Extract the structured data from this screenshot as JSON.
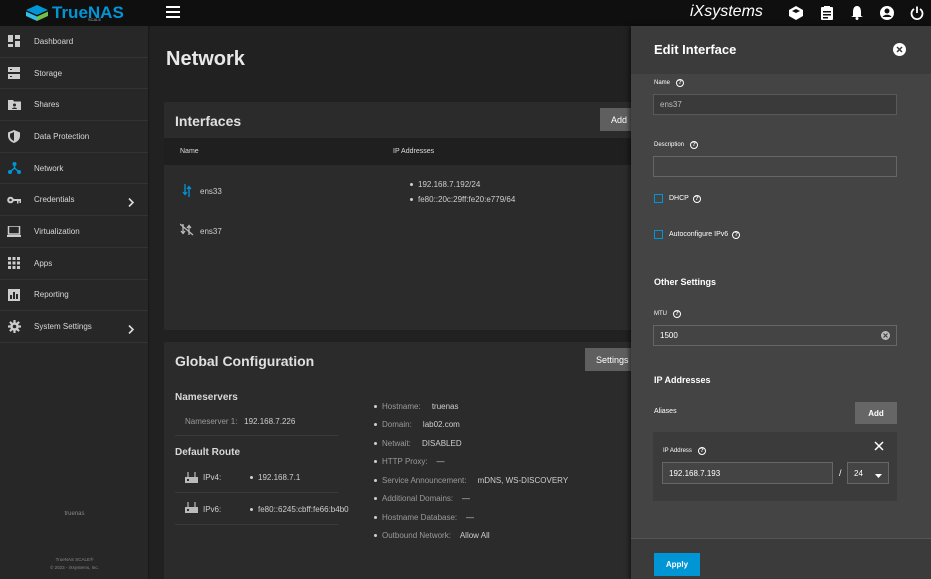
{
  "app": {
    "logo_text": "TrueNAS",
    "logo_sub": "SCALE",
    "vendor": "iXsystems"
  },
  "sidebar": {
    "items": [
      {
        "label": "Dashboard",
        "icon": "dashboard-icon"
      },
      {
        "label": "Storage",
        "icon": "storage-icon"
      },
      {
        "label": "Shares",
        "icon": "shares-icon"
      },
      {
        "label": "Data Protection",
        "icon": "shield-icon"
      },
      {
        "label": "Network",
        "icon": "network-icon"
      },
      {
        "label": "Credentials",
        "icon": "key-icon"
      },
      {
        "label": "Virtualization",
        "icon": "laptop-icon"
      },
      {
        "label": "Apps",
        "icon": "apps-grid-icon"
      },
      {
        "label": "Reporting",
        "icon": "chart-icon"
      },
      {
        "label": "System Settings",
        "icon": "gear-icon"
      }
    ],
    "footer_host": "truenas",
    "footer_product": "TrueNAS SCALE®",
    "footer_copyright": "© 2023 - iXsystems, Inc."
  },
  "page": {
    "title": "Network"
  },
  "interfaces": {
    "title": "Interfaces",
    "add_label": "Add",
    "col_name": "Name",
    "col_ip": "IP Addresses",
    "rows": [
      {
        "name": "ens33",
        "ips": [
          "192.168.7.192/24",
          "fe80::20c:29ff:fe20:e779/64"
        ]
      },
      {
        "name": "ens37",
        "ips": []
      }
    ]
  },
  "global": {
    "title": "Global Configuration",
    "settings_label": "Settings",
    "nameservers_title": "Nameservers",
    "nameserver1_label": "Nameserver 1:",
    "nameserver1_value": "192.168.7.226",
    "default_route_title": "Default Route",
    "ipv4_label": "IPv4:",
    "ipv4_value": "192.168.7.1",
    "ipv6_label": "IPv6:",
    "ipv6_value": "fe80::6245:cbff:fe66:b4b0",
    "hostname_label": "Hostname:",
    "hostname_value": "truenas",
    "domain_label": "Domain:",
    "domain_value": "lab02.com",
    "netwait_label": "Netwait:",
    "netwait_value": "DISABLED",
    "proxy_label": "HTTP Proxy:",
    "proxy_value": "—",
    "service_label": "Service Announcement:",
    "service_value": "mDNS, WS-DISCOVERY",
    "add_domains_label": "Additional Domains:",
    "add_domains_value": "—",
    "hostdb_label": "Hostname Database:",
    "hostdb_value": "—",
    "outbound_label": "Outbound Network:",
    "outbound_value": "Allow All"
  },
  "edit": {
    "title": "Edit Interface",
    "name_label": "Name",
    "name_value": "ens37",
    "description_label": "Description",
    "description_value": "",
    "dhcp_label": "DHCP",
    "dhcp_checked": false,
    "ipv6_label": "Autoconfigure IPv6",
    "ipv6_checked": false,
    "other_settings_title": "Other Settings",
    "mtu_label": "MTU",
    "mtu_value": "1500",
    "ip_addresses_title": "IP Addresses",
    "aliases_label": "Aliases",
    "add_label": "Add",
    "alias_ip_label": "IP Address",
    "alias_ip_value": "192.168.7.193",
    "alias_sep": "/",
    "alias_mask_value": "24",
    "apply_label": "Apply"
  },
  "colors": {
    "accent": "#0095d5",
    "topbar": "#0f0f0f",
    "sidebar": "#272727"
  }
}
